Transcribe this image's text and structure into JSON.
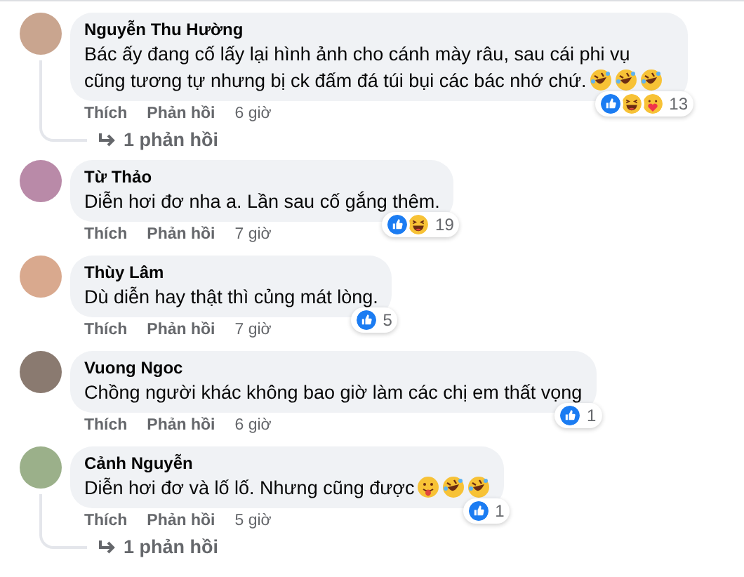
{
  "comments": [
    {
      "author": "Nguyễn Thu Hường",
      "text": "Bác ấy đang cố lấy lại hình ảnh cho cánh mày râu, sau cái phi vụ cũng tương tự nhưng bị ck đấm đá túi bụi các bác nhớ chứ.",
      "emojis": [
        {
          "kind": "rofl"
        },
        {
          "kind": "rofl"
        },
        {
          "kind": "rofl"
        }
      ],
      "reactions": [
        {
          "kind": "like"
        },
        {
          "kind": "haha"
        },
        {
          "kind": "care"
        }
      ],
      "reaction_count": "13",
      "actions": [
        "Thích",
        "Phản hồi"
      ],
      "time": "6 giờ",
      "replies": "1 phản hồi"
    },
    {
      "author": "Từ Thảo",
      "text": "Diễn hơi đơ nha a. Lần sau cố gắng thêm.",
      "reactions": [
        {
          "kind": "like"
        },
        {
          "kind": "haha"
        }
      ],
      "reaction_count": "19",
      "actions": [
        "Thích",
        "Phản hồi"
      ],
      "time": "7 giờ"
    },
    {
      "author": "Thùy Lâm",
      "text": "Dù diễn hay thật thì củng mát lòng.",
      "reactions": [
        {
          "kind": "like"
        }
      ],
      "reaction_count": "5",
      "actions": [
        "Thích",
        "Phản hồi"
      ],
      "time": "7 giờ"
    },
    {
      "author": "Vuong Ngoc",
      "text": "Chồng người khác không bao giờ làm các chị em thất vọng",
      "reactions": [
        {
          "kind": "like"
        }
      ],
      "reaction_count": "1",
      "actions": [
        "Thích",
        "Phản hồi"
      ],
      "time": "6 giờ"
    },
    {
      "author": "Cảnh Nguyễn",
      "text": "Diễn hơi đơ và lố lố. Nhưng cũng được",
      "emojis": [
        {
          "kind": "tongue"
        },
        {
          "kind": "rofl"
        },
        {
          "kind": "rofl"
        }
      ],
      "reactions": [
        {
          "kind": "like"
        }
      ],
      "reaction_count": "1",
      "actions": [
        "Thích",
        "Phản hồi"
      ],
      "time": "5 giờ",
      "replies": "1 phản hồi"
    }
  ]
}
